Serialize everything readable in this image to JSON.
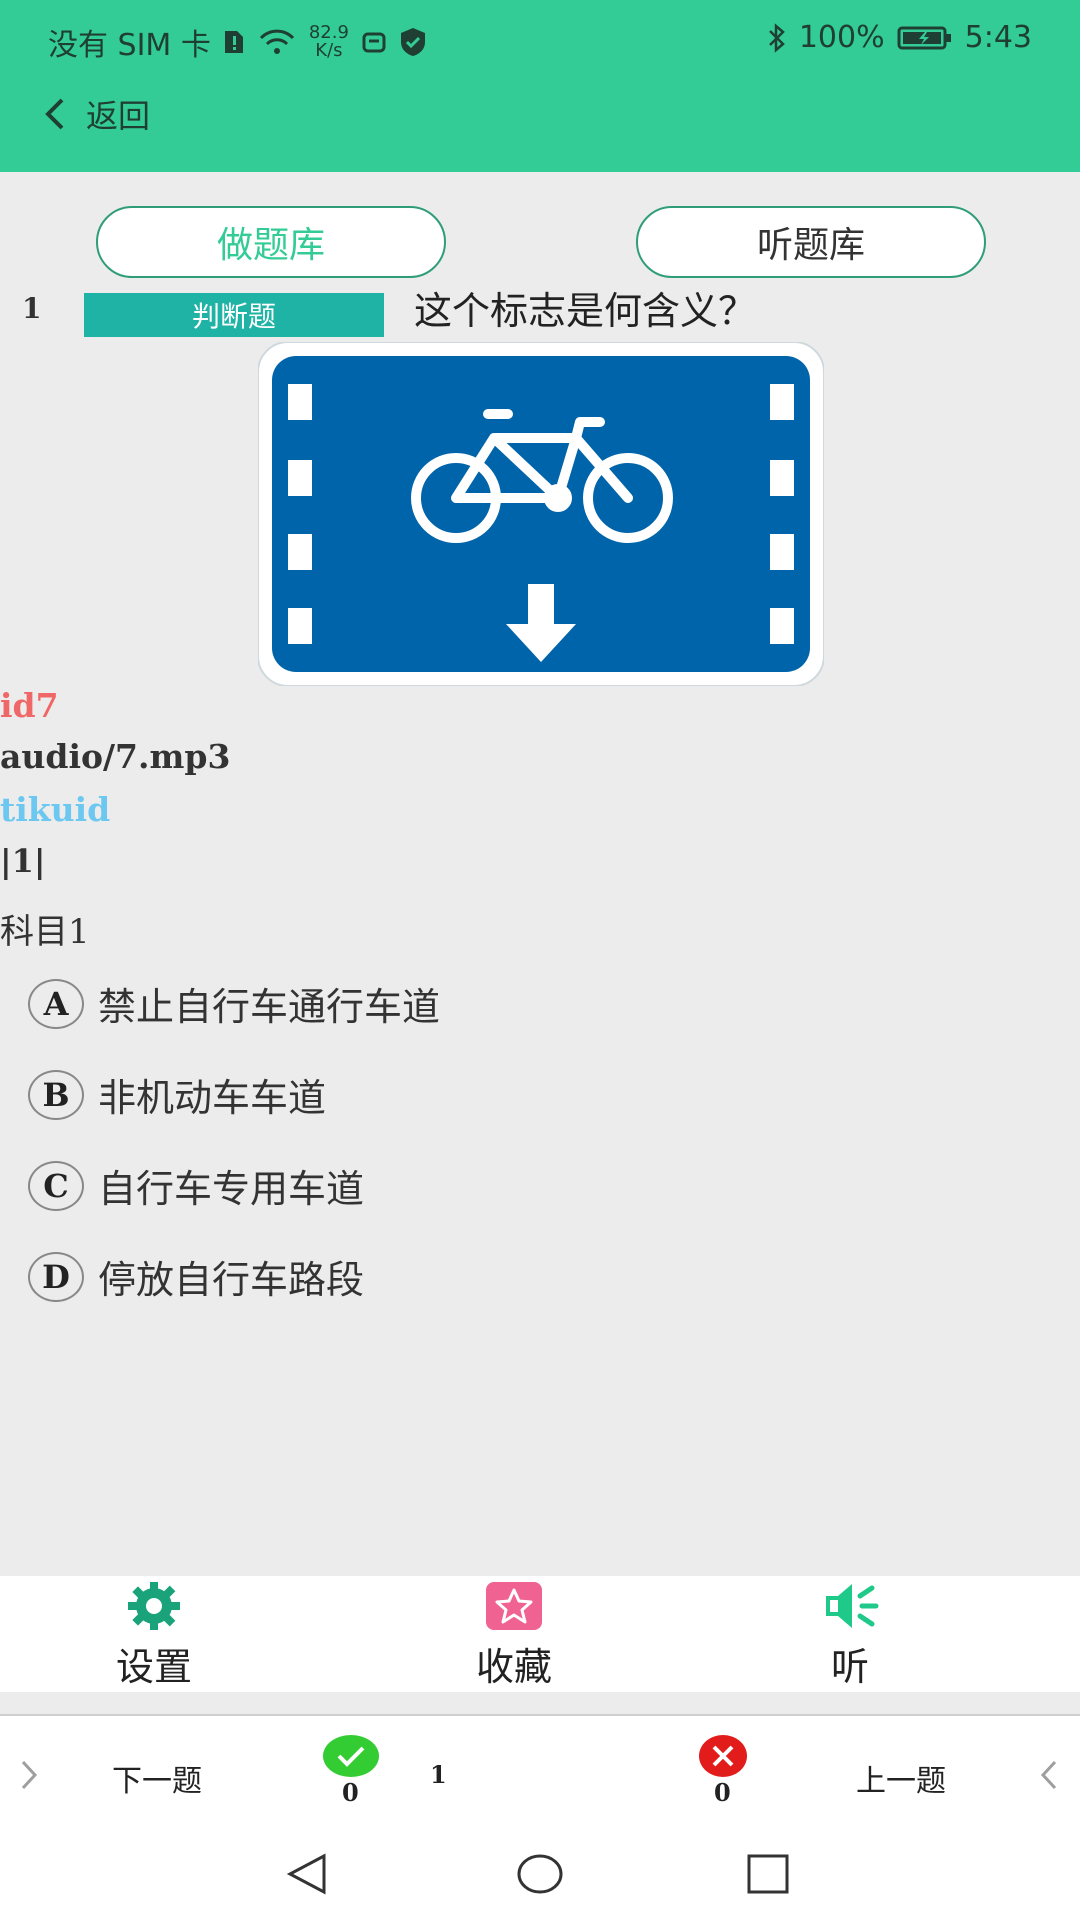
{
  "status": {
    "carrier": "没有 SIM 卡",
    "speed_value": "82.9",
    "speed_unit": "K/s",
    "battery": "100%",
    "time": "5:43"
  },
  "header": {
    "back_label": "返回"
  },
  "tabs": [
    {
      "label": "做题库",
      "active": true
    },
    {
      "label": "听题库",
      "active": false
    }
  ],
  "question": {
    "number": "1",
    "type": "判断题",
    "text": "这个标志是何含义？"
  },
  "debug": {
    "id": "id7",
    "audio": "audio/7.mp3",
    "tikuid": "tikuid",
    "flag": "|1|",
    "subject": "科目1"
  },
  "options": [
    {
      "key": "A",
      "label": "禁止自行车通行车道"
    },
    {
      "key": "B",
      "label": "非机动车车道"
    },
    {
      "key": "C",
      "label": "自行车专用车道"
    },
    {
      "key": "D",
      "label": "停放自行车路段"
    }
  ],
  "toolbar": {
    "settings_label": "设置",
    "favorite_label": "收藏",
    "listen_label": "听"
  },
  "navbar": {
    "next_label": "下一题",
    "prev_label": "上一题",
    "correct_count": "0",
    "wrong_count": "0",
    "current_index": "1"
  },
  "colors": {
    "accent": "#33cc96",
    "type_badge": "#1fb3a6",
    "sign_blue": "#0064aa",
    "correct": "#33cc33",
    "wrong": "#e21b1b",
    "favorite": "#f06292"
  }
}
